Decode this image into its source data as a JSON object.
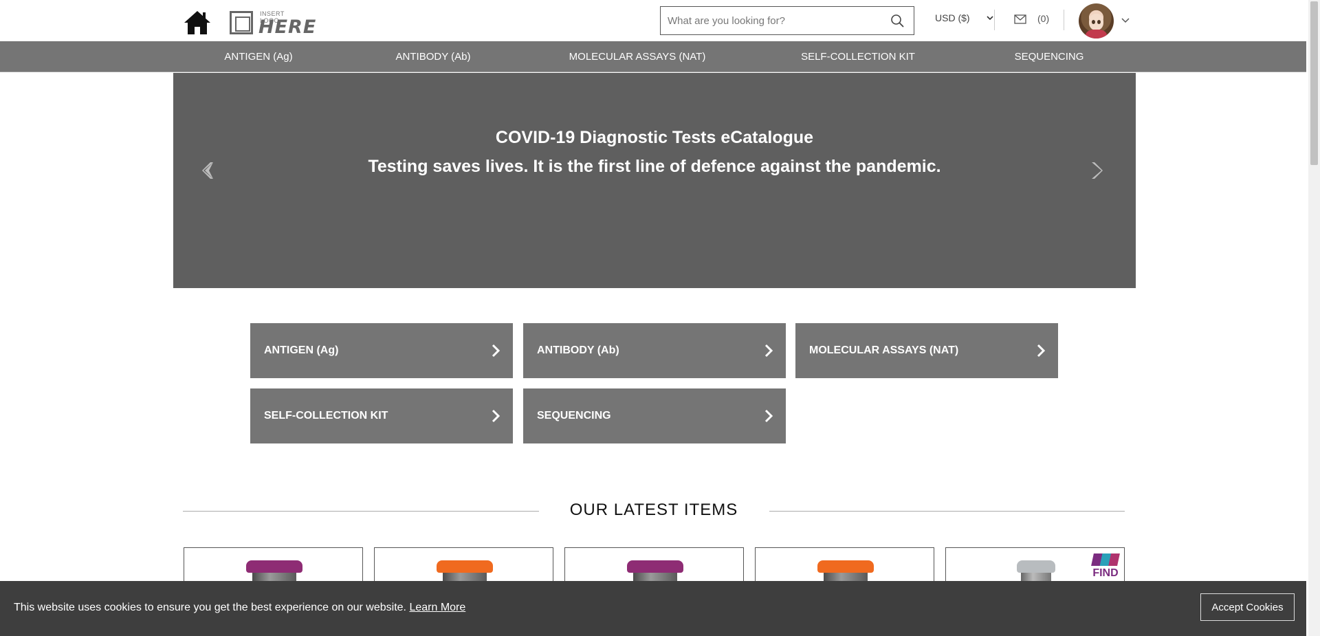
{
  "header": {
    "logo_small": "INSERT LOGO",
    "logo_big": "HERE",
    "search_placeholder": "What are you looking for?",
    "currency": "USD ($)",
    "messages_count": "(0)"
  },
  "nav": {
    "items": [
      {
        "label": "ANTIGEN (Ag)"
      },
      {
        "label": "ANTIBODY (Ab)"
      },
      {
        "label": "MOLECULAR ASSAYS (NAT)"
      },
      {
        "label": "SELF-COLLECTION KIT"
      },
      {
        "label": "SEQUENCING"
      }
    ]
  },
  "hero": {
    "title": "COVID-19 Diagnostic Tests eCatalogue",
    "subtitle": "Testing saves lives. It is the first line of defence against the pandemic."
  },
  "categories": [
    {
      "label": "ANTIGEN (Ag)"
    },
    {
      "label": "ANTIBODY (Ab)"
    },
    {
      "label": "MOLECULAR ASSAYS (NAT)"
    },
    {
      "label": "SELF-COLLECTION KIT"
    },
    {
      "label": "SEQUENCING"
    }
  ],
  "latest": {
    "heading": "OUR LATEST ITEMS",
    "items": [
      {
        "image": "vial-purple-cap",
        "cap_color": "#8e2c74"
      },
      {
        "image": "vial-orange-cap",
        "cap_color": "#f06a1f"
      },
      {
        "image": "vial-purple-cap",
        "cap_color": "#8e2c74"
      },
      {
        "image": "vial-orange-cap",
        "cap_color": "#f06a1f"
      },
      {
        "image": "vial-clear-with-find-logo",
        "cap_color": "#b8bcbf",
        "badge": "FIND"
      }
    ]
  },
  "cookie": {
    "message": "This website uses cookies to ensure you get the best experience on our website.",
    "link": "Learn More",
    "accept": "Accept Cookies"
  },
  "colors": {
    "nav_bg": "#757575",
    "hero_bg": "#5f5f5f",
    "tile_bg": "#757575",
    "cookie_bg": "#3e3e3e"
  }
}
